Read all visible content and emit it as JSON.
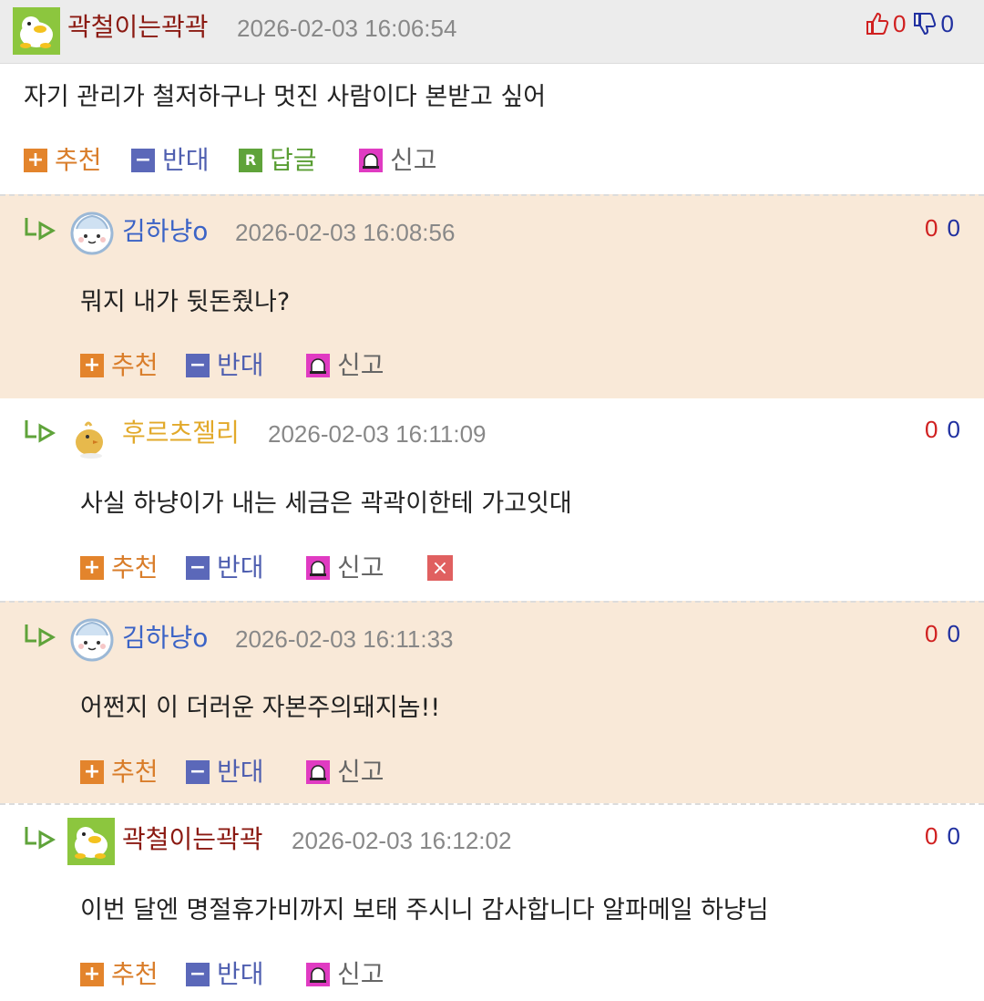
{
  "colors": {
    "reply_bg": "#f9e9d8",
    "header_bg": "#ececec",
    "recommend": "#e3842c",
    "oppose": "#5b68b9",
    "reply": "#5fa33a",
    "report": "#e03bc2",
    "delete": "#e06060"
  },
  "comments": [
    {
      "nickname": "곽철이는곽곽",
      "date": "2026-02-03 16:06:54",
      "body": "자기 관리가 철저하구나 멋진 사람이다 본받고 싶어",
      "up": "0",
      "down": "0",
      "avatar": "duck-avatar-icon"
    },
    {
      "nickname": "김하냥o",
      "date": "2026-02-03 16:08:56",
      "body": "뭐지 내가 뒷돈줬나?",
      "up": "0",
      "down": "0",
      "avatar": "cloud-face-avatar-icon"
    },
    {
      "nickname": "후르츠젤리",
      "date": "2026-02-03 16:11:09",
      "body": "사실 하냥이가 내는 세금은 곽곽이한테 가고잇대",
      "up": "0",
      "down": "0",
      "avatar": "chick-avatar-icon"
    },
    {
      "nickname": "김하냥o",
      "date": "2026-02-03 16:11:33",
      "body": "어쩐지 이 더러운 자본주의돼지놈!!",
      "up": "0",
      "down": "0",
      "avatar": "cloud-face-avatar-icon"
    },
    {
      "nickname": "곽철이는곽곽",
      "date": "2026-02-03 16:12:02",
      "body": "이번 달엔 명절휴가비까지 보태 주시니 감사합니다 알파메일 하냥님",
      "up": "0",
      "down": "0",
      "avatar": "duck-avatar-icon"
    }
  ],
  "actions": {
    "recommend": "추천",
    "oppose": "반대",
    "reply": "답글",
    "report": "신고",
    "reply_icon_letter": "R",
    "delete_icon": "×"
  }
}
